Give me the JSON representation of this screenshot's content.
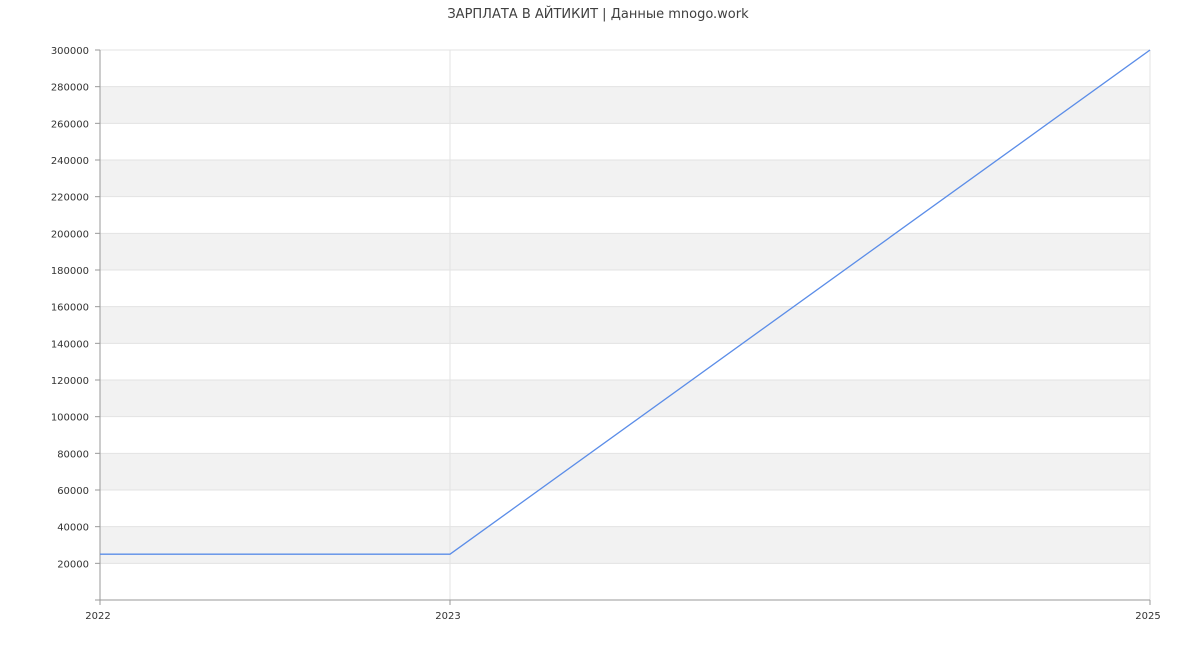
{
  "chart_data": {
    "type": "line",
    "title": "ЗАРПЛАТА В АЙТИКИТ | Данные mnogo.work",
    "xlabel": "",
    "ylabel": "",
    "x": [
      "2022",
      "2023",
      "2025"
    ],
    "series": [
      {
        "values": [
          25000,
          25000,
          300000
        ]
      }
    ],
    "ylim": [
      0,
      300000
    ],
    "yticks": [
      "20000",
      "40000",
      "60000",
      "80000",
      "100000",
      "120000",
      "140000",
      "160000",
      "180000",
      "200000",
      "220000",
      "240000",
      "260000",
      "280000",
      "300000"
    ],
    "xticks": [
      "2022",
      "2023",
      "2025"
    ],
    "grid": true,
    "legend": "none",
    "colors": {
      "line": "#5b8de8",
      "band": "#f2f2f2",
      "grid": "#e3e3e3",
      "axis": "#999999"
    }
  }
}
